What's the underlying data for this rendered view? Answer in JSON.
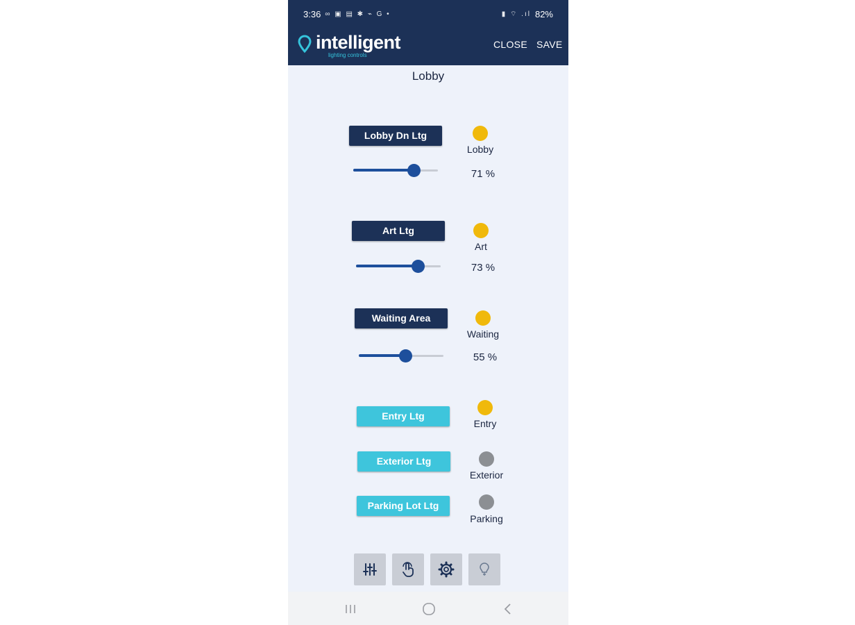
{
  "status_bar": {
    "time": "3:36",
    "left_icons": "∞ ▣ ▤ ✱ ⌁ G •",
    "right_icons": "▮ ⌔ .ıl",
    "battery": "82%"
  },
  "app": {
    "logo_word": "intelligent",
    "logo_tagline": "lighting controls",
    "close_label": "CLOSE",
    "save_label": "SAVE"
  },
  "page_title": "Lobby",
  "colors": {
    "header": "#1c3157",
    "on_indicator": "#f0b90b",
    "off_indicator": "#8c8f93",
    "scene_dark": "#1c3157",
    "scene_light": "#3ec5dc",
    "slider": "#1d4f9c"
  },
  "zones": [
    {
      "button": "Lobby Dn Ltg",
      "indicator_label": "Lobby",
      "state": "on",
      "level_text": "71 %",
      "level": 71
    },
    {
      "button": "Art Ltg",
      "indicator_label": "Art",
      "state": "on",
      "level_text": "73 %",
      "level": 73
    },
    {
      "button": "Waiting Area",
      "indicator_label": "Waiting",
      "state": "on",
      "level_text": "55 %",
      "level": 55
    },
    {
      "button": "Entry Ltg",
      "indicator_label": "Entry",
      "state": "on"
    },
    {
      "button": "Exterior Ltg",
      "indicator_label": "Exterior",
      "state": "off"
    },
    {
      "button": "Parking Lot Ltg",
      "indicator_label": "Parking",
      "state": "off"
    }
  ],
  "toolbar": [
    {
      "icon": "sliders-icon",
      "selected": false
    },
    {
      "icon": "touch-icon",
      "selected": false
    },
    {
      "icon": "settings-icon",
      "selected": false
    },
    {
      "icon": "bulb-icon",
      "selected": false
    }
  ],
  "nav": [
    "recents-icon",
    "home-icon",
    "back-icon"
  ]
}
